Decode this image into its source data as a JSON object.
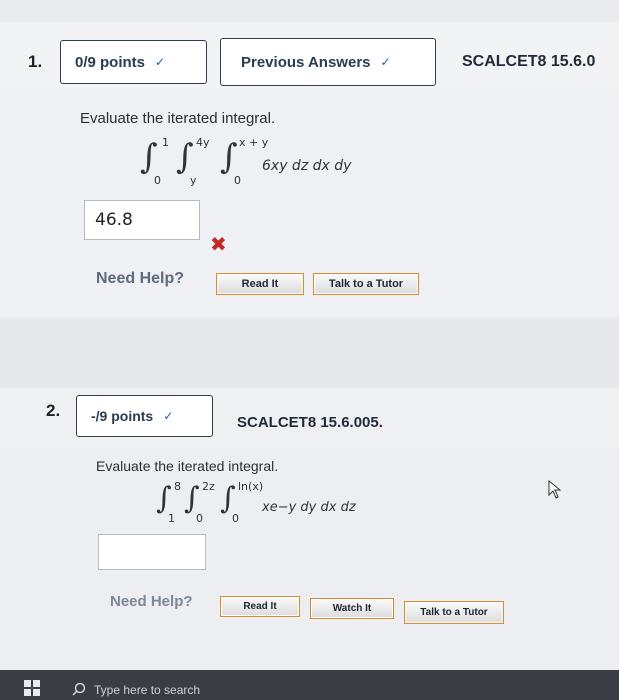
{
  "q1": {
    "number": "1.",
    "points": "0/9 points",
    "prev_answers": "Previous Answers",
    "code": "SCALCET8 15.6.0",
    "prompt": "Evaluate the iterated integral.",
    "integral": {
      "outer_upper": "1",
      "outer_lower": "0",
      "middle_upper": "4y",
      "middle_lower": "y",
      "inner_upper": "x + y",
      "inner_lower": "0",
      "integrand": "6xy dz dx dy"
    },
    "answer_value": "46.8",
    "need_help": "Need Help?",
    "buttons": [
      "Read It",
      "Talk to a Tutor"
    ]
  },
  "q2": {
    "number": "2.",
    "points": "-/9 points",
    "code": "SCALCET8 15.6.005.",
    "prompt": "Evaluate the iterated integral.",
    "integral": {
      "outer_upper": "8",
      "outer_lower": "1",
      "middle_upper": "2z",
      "middle_lower": "0",
      "inner_upper": "ln(x)",
      "inner_lower": "0",
      "integrand": "xe−y dy dx dz"
    },
    "answer_value": "",
    "need_help": "Need Help?",
    "buttons": [
      "Read It",
      "Watch It",
      "Talk to a Tutor"
    ]
  },
  "taskbar": {
    "search_placeholder": "Type here to search"
  },
  "colors": {
    "wrong_mark": "#c62828",
    "button_border": "#d98a2c"
  }
}
